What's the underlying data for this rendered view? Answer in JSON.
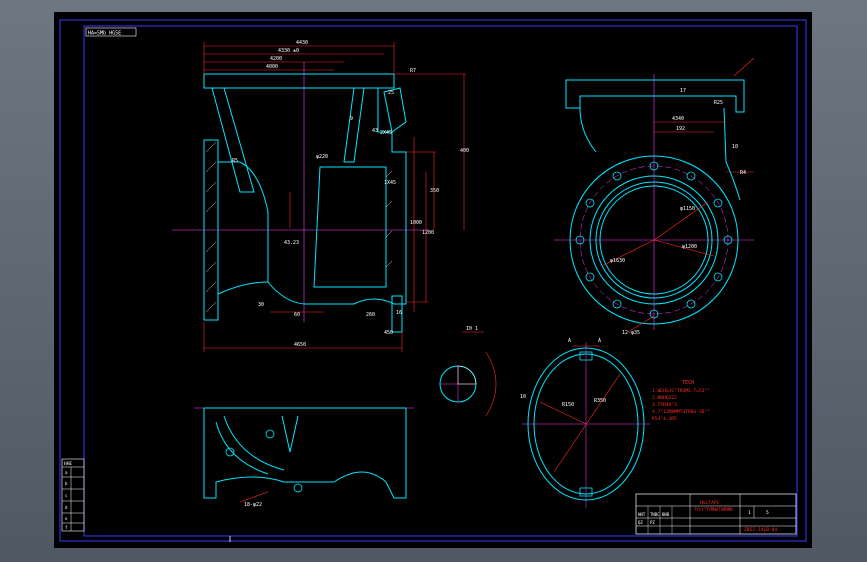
{
  "colors": {
    "background": "#000000",
    "frame": "#3a3aff",
    "outline": "#00e5ff",
    "dimension": "#ff2a2a",
    "center": "#ff3cff",
    "text_white": "#ffffff",
    "hatch": "#ffffff"
  },
  "title_stamp": "HA=5Mb HG5E",
  "labels": {
    "section_label": "I0 1",
    "section_a": "A",
    "section_a2": "A",
    "sheet_left": "1",
    "sheet_right": "5"
  },
  "front_view_dims": {
    "top_1": "4430",
    "top_2": "4330 ±0",
    "top_3": "4200",
    "top_4": "4000",
    "top_r": "R7",
    "angle_1": "25",
    "angle_2": "43",
    "angle_3": "9",
    "right_v1": "400",
    "right_v2": "350",
    "right_v3": "1200",
    "right_v4": "1000",
    "mid_1": "43.23",
    "mid_2": "φ220",
    "mid_3": "2X45",
    "mid_4": "1X45",
    "bottom_1": "4650",
    "bottom_2": "450",
    "bottom_3": "60",
    "bottom_4": "260",
    "small_1": "R5",
    "small_2": "16",
    "small_3": "30"
  },
  "side_view_dims": {
    "top_1": "4340",
    "top_2": "192",
    "top_3": "17",
    "top_4": "R25",
    "right_1": "10",
    "right_2": "R4",
    "mid_1": "φ1630",
    "mid_2": "φ1200",
    "mid_3": "φ1150",
    "bottom_1": "12-φ35"
  },
  "bottom_view_dims": {
    "dim_1": "18-φ22"
  },
  "oval_section_dims": {
    "dim_1": "R150",
    "dim_2": "R350",
    "dim_3": "10"
  },
  "notes": {
    "heading": "TECH",
    "lines": [
      "1.WEHSJC°TROMS T=53°°",
      "2.BNHQ222",
      "3.TPR44°3",
      "4.7°12M8MMT4TR0S-36°°",
      "  R54°4.3R5"
    ]
  },
  "title_block": {
    "part_name": "HSLTAPC",
    "part_sub": "TYLY°TYMNHTARMMN",
    "drawing_no": "ZBSJ-1418-04",
    "scale": "1:1",
    "sheet": "1",
    "rows": [
      "HNT",
      "TNBC",
      "BNB",
      "QZ",
      "PZ"
    ]
  },
  "left_table": {
    "header": "HHE",
    "rows": [
      "a",
      "b",
      "c",
      "d",
      "e",
      "f"
    ]
  }
}
